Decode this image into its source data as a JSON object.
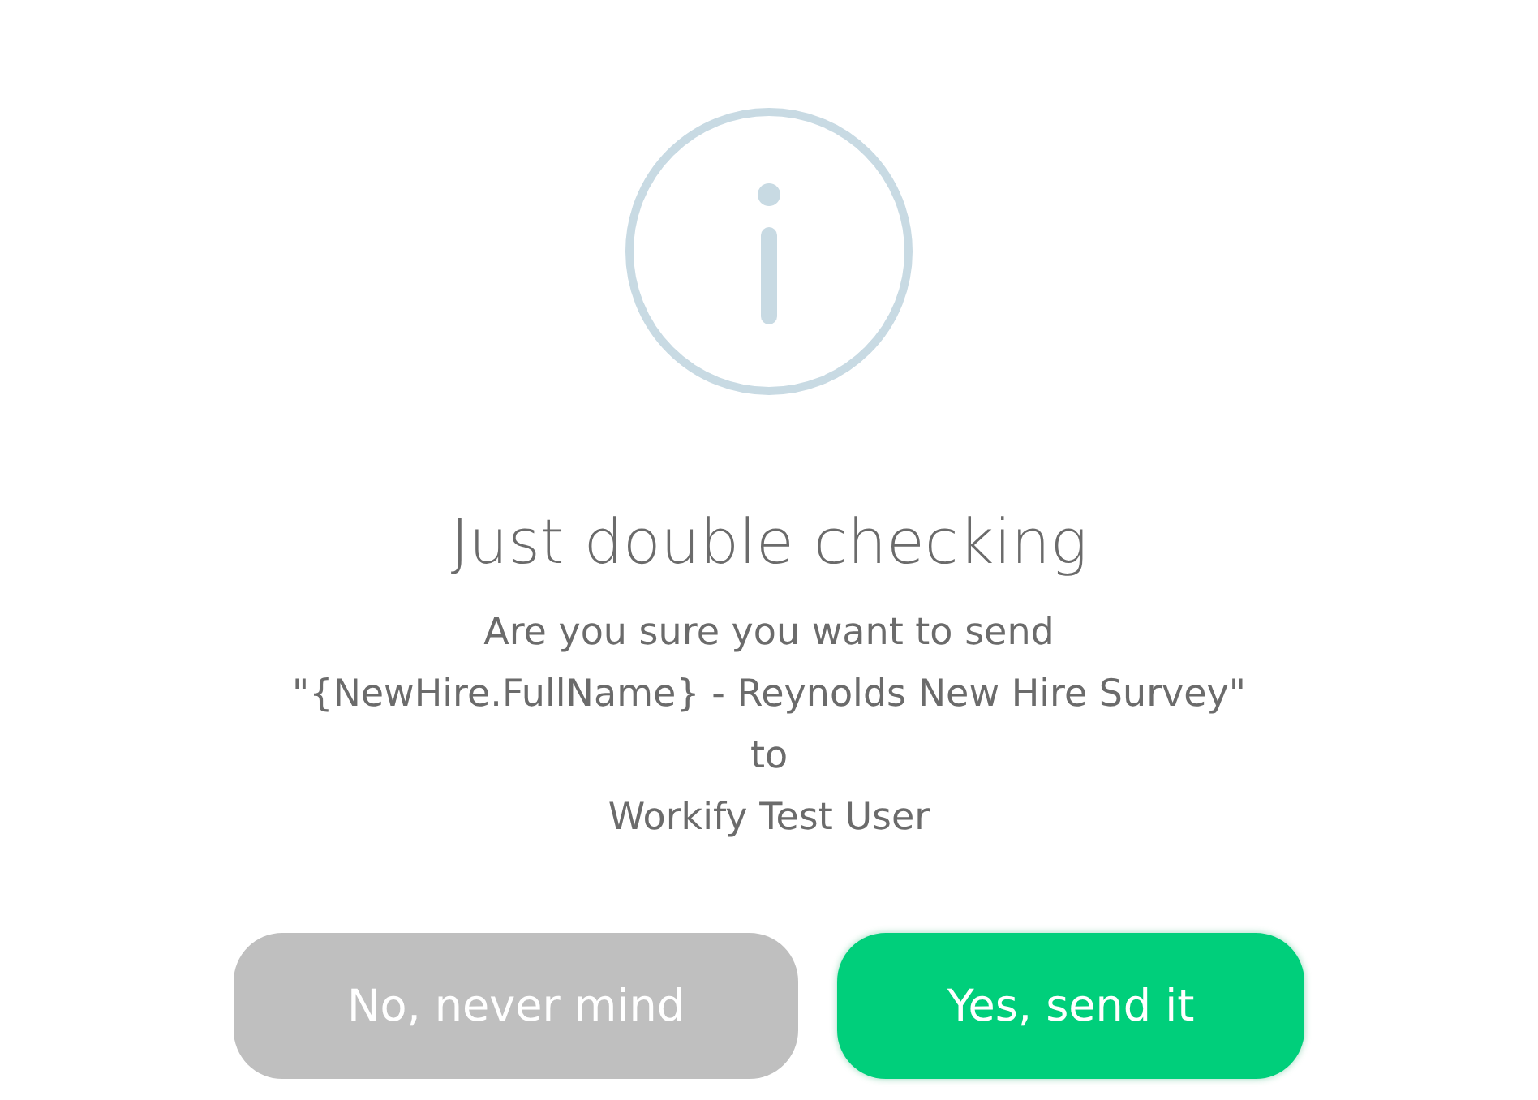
{
  "dialog": {
    "title": "Just double checking",
    "message_lines": [
      "Are you sure you want to send",
      "\"{NewHire.FullName} - Reynolds New Hire Survey\"",
      "to",
      "Workify Test User"
    ],
    "buttons": [
      {
        "label": "No, never mind",
        "kind": "cancel"
      },
      {
        "label": "Yes, send it",
        "kind": "confirm"
      }
    ]
  }
}
